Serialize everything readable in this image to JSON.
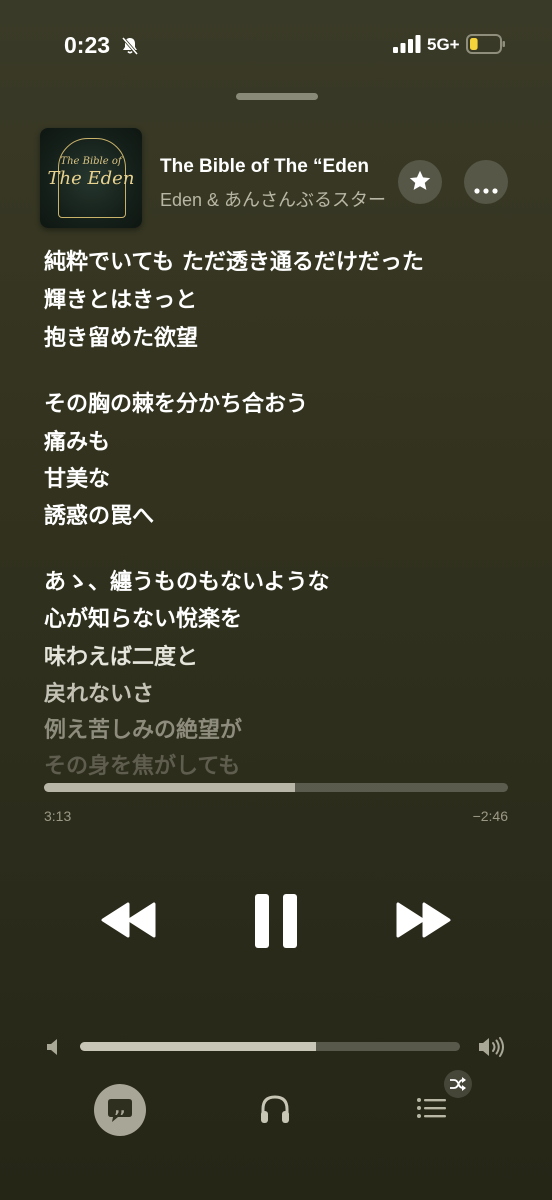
{
  "status": {
    "time": "0:23",
    "network": "5G+",
    "icons": [
      "bell-slash-icon",
      "signal-icon",
      "battery-icon"
    ],
    "battery_level": 0.2
  },
  "track": {
    "title": "The Bible of The “Eden",
    "artist": "Eden & あんさんぶるスター",
    "artwork_title_line1": "The Bible of",
    "artwork_title_line2": "The Eden"
  },
  "lyrics": [
    "純粋でいても ただ透き通るだけだった",
    "輝きとはきっと",
    "抱き留めた欲望",
    "その胸の棘を分かち合おう",
    "痛みも",
    "甘美な",
    "誘惑の罠へ",
    "あゝ、纏うものもないような",
    "心が知らない悅楽を",
    "味わえば二度と",
    "戻れないさ",
    "例え苦しみの絶望が",
    "その身を焦がしても"
  ],
  "playback": {
    "elapsed": "3:13",
    "remaining": "−2:46",
    "progress": 0.54,
    "volume": 0.62,
    "state": "playing"
  },
  "controls": {
    "icons": [
      "rewind-icon",
      "pause-icon",
      "fast-forward-icon",
      "star-icon",
      "more-icon",
      "lyrics-icon",
      "airplay-icon",
      "queue-icon",
      "shuffle-icon",
      "volume-low-icon",
      "volume-high-icon"
    ]
  }
}
